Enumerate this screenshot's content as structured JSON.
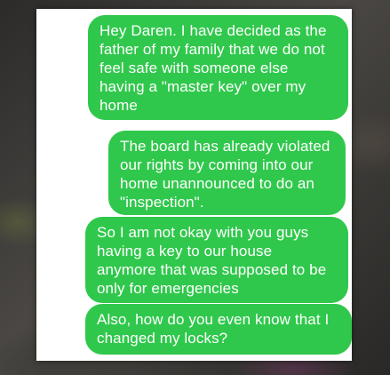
{
  "conversation": {
    "bubble_color": "#30c84c",
    "messages": [
      {
        "text": "Hey Daren. I have decided as the\nfather of my family that we do not\nfeel safe with someone else\nhaving a \"master key\" over my\nhome"
      },
      {
        "text": "The board has already violated\nour rights by coming into our\nhome unannounced to do an\n\"inspection\"."
      },
      {
        "text": "So I am not okay with you guys\nhaving a key to our house\nanymore that was supposed to be\nonly for emergencies"
      },
      {
        "text": "Also, how do you even know that I\nchanged my locks?"
      }
    ]
  }
}
